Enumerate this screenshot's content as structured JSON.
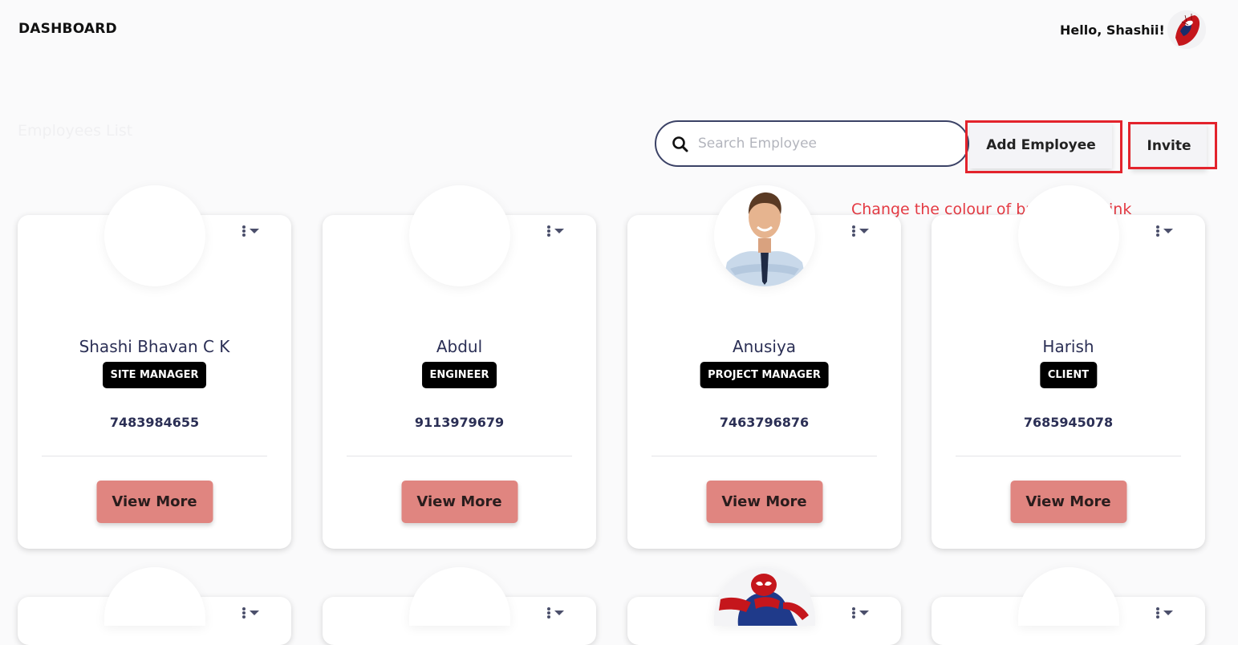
{
  "header": {
    "title": "DASHBOARD",
    "greeting": "Hello, Shashii!"
  },
  "section": {
    "title": "Employees List"
  },
  "search": {
    "placeholder": "Search Employee",
    "value": ""
  },
  "actions": {
    "add_label": "Add Employee",
    "invite_label": "Invite"
  },
  "annotation": {
    "note": "Change the colour of buttons to pink"
  },
  "employees": [
    {
      "name": "Shashi Bhavan C K",
      "role": "SITE MANAGER",
      "phone": "7483984655",
      "button": "View More"
    },
    {
      "name": "Abdul",
      "role": "ENGINEER",
      "phone": "9113979679",
      "button": "View More"
    },
    {
      "name": "Anusiya",
      "role": "PROJECT MANAGER",
      "phone": "7463796876",
      "button": "View More"
    },
    {
      "name": "Harish",
      "role": "CLIENT",
      "phone": "7685945078",
      "button": "View More"
    }
  ],
  "colors": {
    "accent_button": "#e08580",
    "annotation_red": "#e3232c",
    "search_border": "#3b4266",
    "name_text": "#2b2f55"
  },
  "icons": {
    "search": "search-icon",
    "menu": "kebab-menu-icon"
  }
}
